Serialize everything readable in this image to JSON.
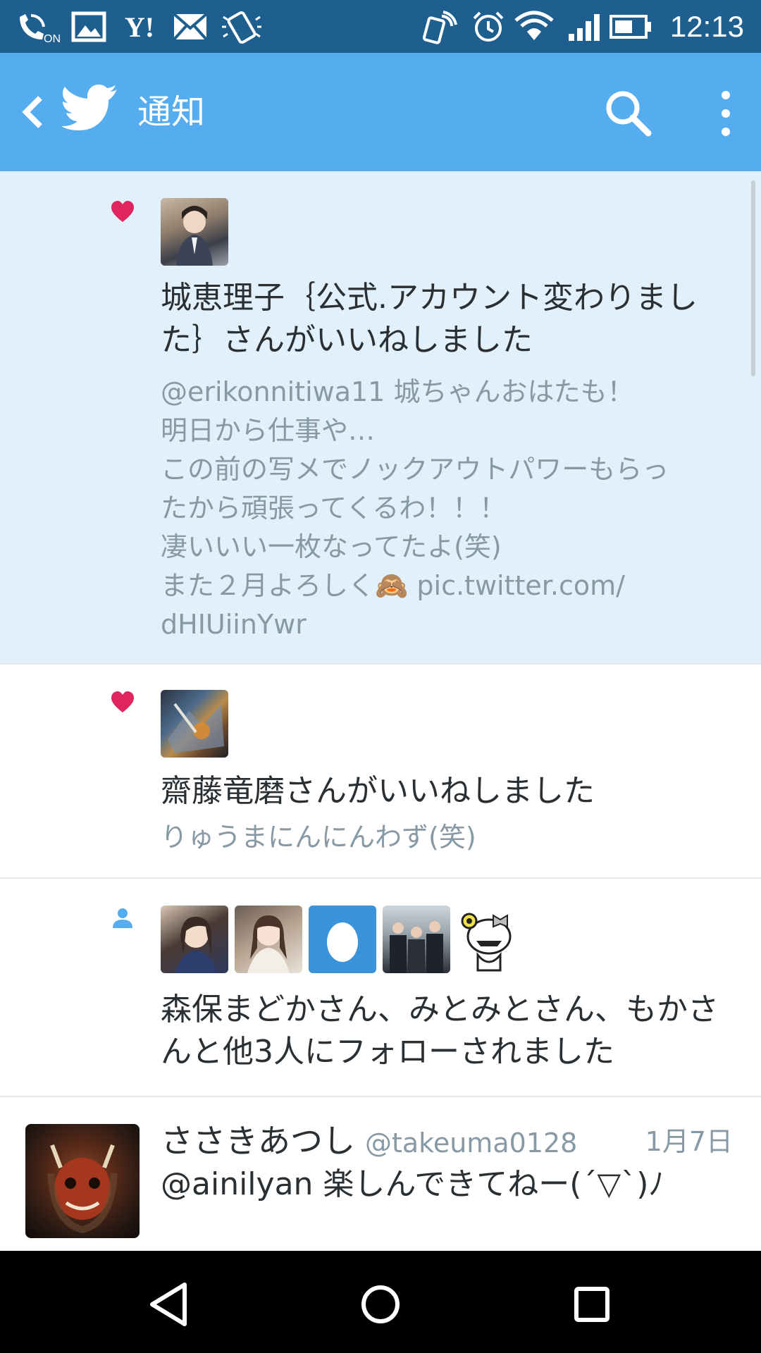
{
  "colors": {
    "statusbar": "#1f5f8f",
    "appbar": "#55acee",
    "highlight": "#e1f0fa",
    "like": "#e0245e",
    "follow": "#55acee",
    "text": "#292f33",
    "muted": "#8899a6"
  },
  "status_bar": {
    "time": "12:13",
    "icons": [
      "volte-on-icon",
      "gallery-icon",
      "yahoo-icon",
      "mail-icon",
      "screen-rotate-icon",
      "nfc-icon",
      "alarm-icon",
      "wifi-icon",
      "signal-icon",
      "battery-icon"
    ],
    "yahoo_text": "Y!",
    "volte_text": "ON"
  },
  "app_bar": {
    "title": "通知"
  },
  "notifications": [
    {
      "type": "like",
      "highlighted": true,
      "headline": "城恵理子｛公式.アカウント変わりました｝さんがいいねしました",
      "snippet_lines": [
        "@erikonnitiwa11 城ちゃんおはたも！",
        "明日から仕事や…",
        "この前の写メでノックアウトパワーもらっ",
        "たから頑張ってくるわ！！！",
        "凄いいい一枚なってたよ(笑)",
        "また２月よろしく🙈 pic.twitter.com/",
        "dHIUiinYwr"
      ]
    },
    {
      "type": "like",
      "highlighted": false,
      "headline": "齋藤竜磨さんがいいねしました",
      "snippet_lines": [
        "りゅうまにんにんわず(笑)"
      ]
    },
    {
      "type": "follow",
      "highlighted": false,
      "headline": "森保まどかさん、みとみとさん、もかさんと他3人にフォローされました",
      "snippet_lines": []
    }
  ],
  "tweet": {
    "name": "ささきあつし",
    "handle": "@takeuma0128",
    "date": "1月7日",
    "text": "@ainilyan 楽しんできてねー(´▽`)ﾉ"
  },
  "nav_bar": {
    "buttons": [
      "back-triangle-icon",
      "home-circle-icon",
      "recents-square-icon"
    ]
  }
}
